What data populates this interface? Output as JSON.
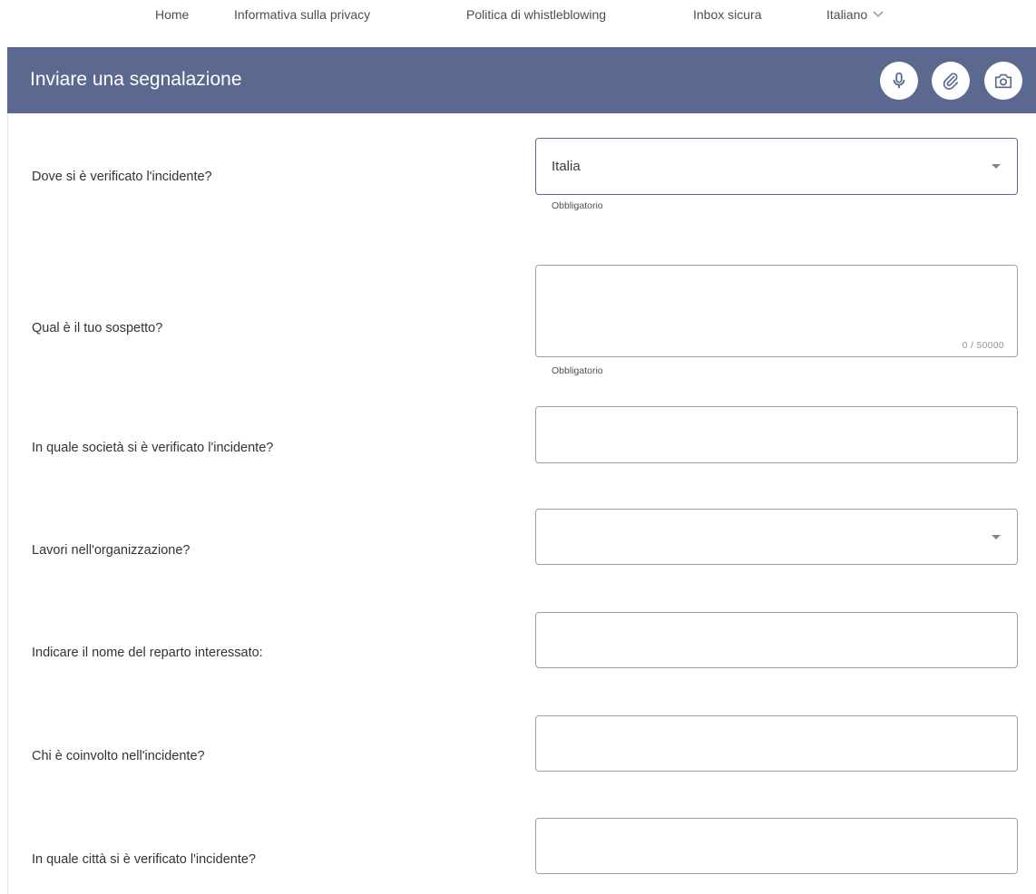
{
  "nav": {
    "items": [
      {
        "label": "Home"
      },
      {
        "label": "Informativa sulla privacy"
      },
      {
        "label": "Politica di whistleblowing"
      },
      {
        "label": "Inbox sicura"
      }
    ],
    "language": "Italiano"
  },
  "header": {
    "title": "Inviare una segnalazione",
    "icons": [
      "microphone-icon",
      "paperclip-icon",
      "camera-icon"
    ]
  },
  "colors": {
    "header_bg": "#5b6890",
    "field_border": "#9aa0a6"
  },
  "form": {
    "questions": [
      {
        "label": "Dove si è verificato l'incidente?",
        "type": "select",
        "value": "Italia",
        "hint": "Obbligatorio"
      },
      {
        "label": "Qual è il tuo sospetto?",
        "type": "textarea",
        "value": "",
        "counter": "0 / 50000",
        "hint": "Obbligatorio"
      },
      {
        "label": "In quale società si è verificato l'incidente?",
        "type": "text",
        "value": ""
      },
      {
        "label": "Lavori nell'organizzazione?",
        "type": "select",
        "value": ""
      },
      {
        "label": "Indicare il nome del reparto interessato:",
        "type": "text",
        "value": ""
      },
      {
        "label": "Chi è coinvolto nell'incidente?",
        "type": "text",
        "value": ""
      },
      {
        "label": "In quale città si è verificato l'incidente?",
        "type": "text",
        "value": ""
      }
    ]
  }
}
